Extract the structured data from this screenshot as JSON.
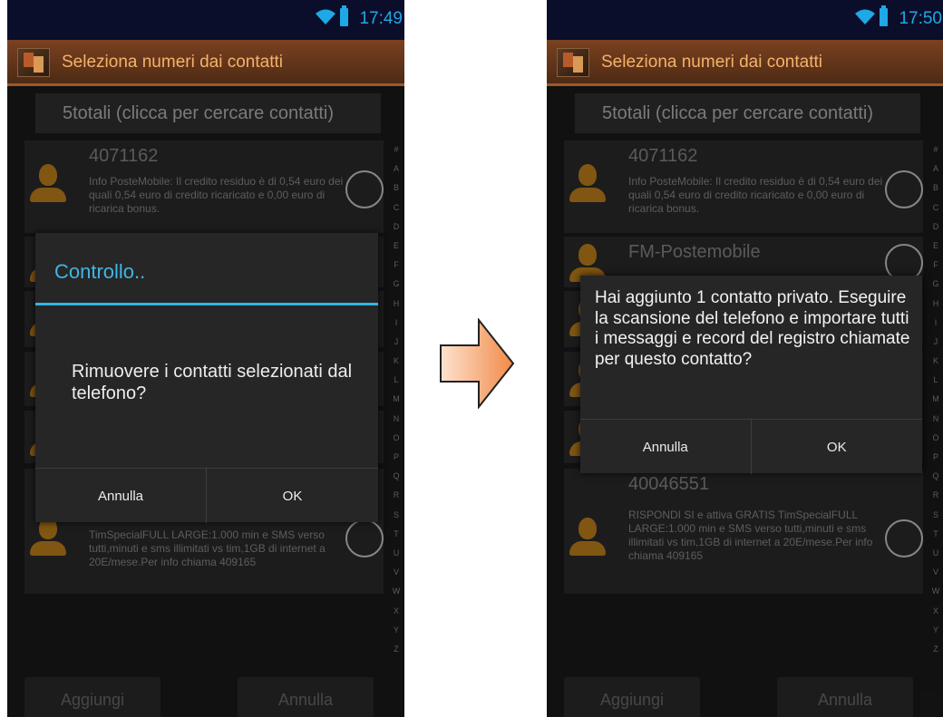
{
  "left": {
    "status_time": "17:49",
    "header_title": "Seleziona numeri dai contatti",
    "search_text": "5totali (clicca per cercare contatti)",
    "contacts": [
      {
        "name": "4071162",
        "msg": "Info PosteMobile: Il credito residuo è di 0,54 euro dei quali 0,54 euro di credito ricaricato e 0,00 euro di ricarica bonus."
      },
      {
        "name": "",
        "msg": ""
      },
      {
        "name": "",
        "msg": ""
      },
      {
        "name": "",
        "msg": ""
      },
      {
        "name": "",
        "msg": ""
      },
      {
        "name": "",
        "msg": "TimSpecialFULL LARGE:1.000 min e SMS verso tutti,minuti e sms illimitati vs tim,1GB di internet a 20E/mese.Per info chiama 409165"
      }
    ],
    "dialog": {
      "title": "Controllo..",
      "message": "Rimuovere i contatti selezionati dal telefono?",
      "cancel_label": "Annulla",
      "ok_label": "OK"
    },
    "add_button": "Aggiungi",
    "cancel_button": "Annulla"
  },
  "right": {
    "status_time": "17:50",
    "header_title": "Seleziona numeri dai contatti",
    "search_text": "5totali (clicca per cercare contatti)",
    "contacts": [
      {
        "name": "4071162",
        "msg": "Info PosteMobile: Il credito residuo è di 0,54 euro dei quali 0,54 euro di credito ricaricato e 0,00 euro di ricarica bonus."
      },
      {
        "name": "FM-Postemobile",
        "msg": ""
      },
      {
        "name": "",
        "msg": ""
      },
      {
        "name": "",
        "msg": ""
      },
      {
        "name": "",
        "msg": ""
      },
      {
        "name": "40046551",
        "msg": "RISPONDI SI e attiva GRATIS TimSpecialFULL LARGE:1.000 min e SMS verso tutti,minuti e sms illimitati vs tim,1GB di internet a 20E/mese.Per info chiama 409165"
      }
    ],
    "dialog": {
      "message": "Hai aggiunto 1 contatto privato. Eseguire la scansione del telefono e importare tutti i messaggi e record del registro chiamate per questo contatto?",
      "cancel_label": "Annulla",
      "ok_label": "OK"
    },
    "add_button": "Aggiungi",
    "cancel_button": "Annulla"
  },
  "index_letters": [
    "#",
    "A",
    "B",
    "C",
    "D",
    "E",
    "F",
    "G",
    "H",
    "I",
    "J",
    "K",
    "L",
    "M",
    "N",
    "O",
    "P",
    "Q",
    "R",
    "S",
    "T",
    "U",
    "V",
    "W",
    "X",
    "Y",
    "Z"
  ],
  "colors": {
    "accent_blue": "#33b5e5",
    "header_orange": "#f3b36b",
    "avatar_orange": "#c7841c",
    "arrow_fill": "#f7a66a"
  },
  "icons": {
    "status": [
      "wifi-icon",
      "battery-icon"
    ],
    "app": "app-icon",
    "contact": "person-icon",
    "transition": "right-arrow-icon"
  }
}
